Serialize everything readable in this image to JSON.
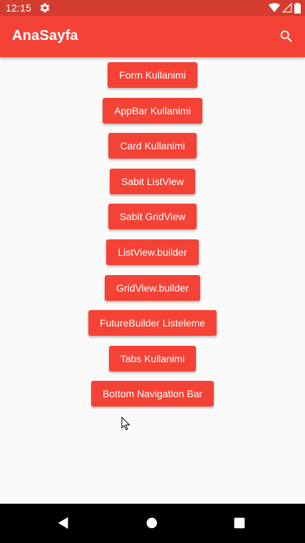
{
  "status_bar": {
    "time": "12:15",
    "icons": [
      "settings-icon",
      "wifi-icon",
      "signal-icon",
      "battery-icon"
    ]
  },
  "app_bar": {
    "title": "AnaSayfa",
    "action_icon": "search-icon"
  },
  "menu": {
    "buttons": [
      {
        "label": "Form Kullanimi"
      },
      {
        "label": "AppBar Kullanimi"
      },
      {
        "label": "Card Kullanimi"
      },
      {
        "label": "Sabit ListView"
      },
      {
        "label": "Sabit GridView"
      },
      {
        "label": "ListView.builder"
      },
      {
        "label": "GridView.builder"
      },
      {
        "label": "FutureBuilder Listeleme"
      },
      {
        "label": "Tabs Kullanimi"
      },
      {
        "label": "Bottom Navigation Bar"
      }
    ]
  },
  "nav_bar": {
    "icons": [
      "back-icon",
      "home-icon",
      "recents-icon"
    ]
  },
  "colors": {
    "primary": "#f44336",
    "status_bar": "#d33c2f",
    "background": "#fafafa",
    "nav_bar": "#000000"
  }
}
